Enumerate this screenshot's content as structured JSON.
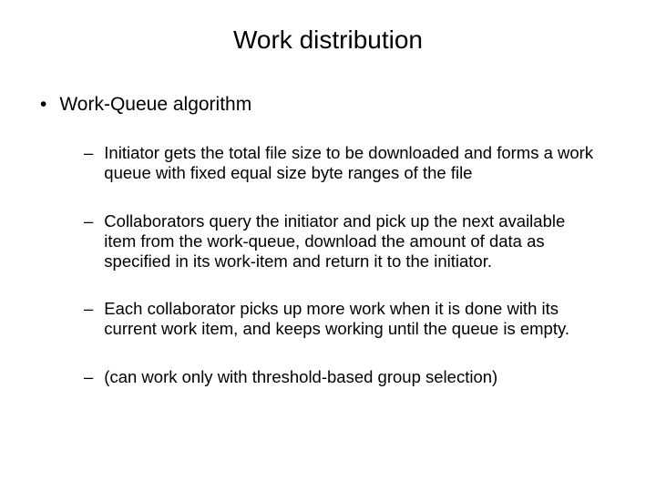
{
  "title": "Work distribution",
  "level1": {
    "text": "Work-Queue algorithm"
  },
  "level2": [
    {
      "text": "Initiator gets the total file size to be downloaded and forms a work queue with fixed equal size byte ranges of the file"
    },
    {
      "text": "Collaborators query the initiator and pick up the next available item from the work-queue, download the amount of data as specified in its work-item and return it to the initiator."
    },
    {
      "text": "Each collaborator picks up more work when it is done with its current work item, and keeps working until the queue is empty."
    },
    {
      "text": "(can work only with threshold-based group selection)"
    }
  ]
}
